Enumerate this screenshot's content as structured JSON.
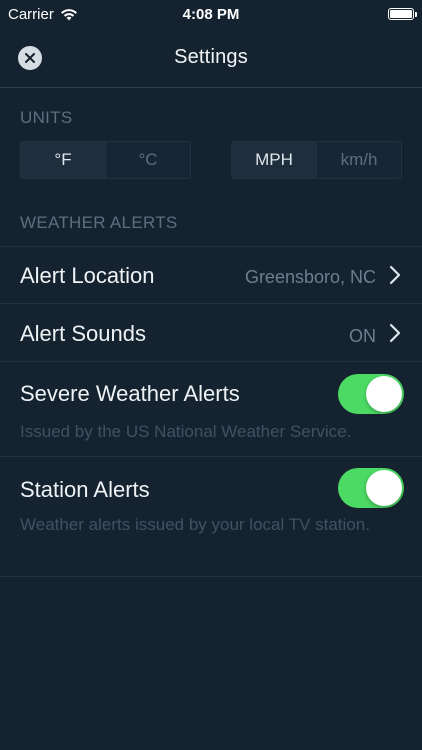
{
  "status_bar": {
    "carrier": "Carrier",
    "time": "4:08 PM"
  },
  "nav": {
    "title": "Settings"
  },
  "units": {
    "header": "UNITS",
    "temperature": {
      "options": [
        "°F",
        "°C"
      ],
      "selected": "°F"
    },
    "speed": {
      "options": [
        "MPH",
        "km/h"
      ],
      "selected": "MPH"
    }
  },
  "weather_alerts": {
    "header": "WEATHER ALERTS",
    "alert_location": {
      "label": "Alert Location",
      "value": "Greensboro, NC"
    },
    "alert_sounds": {
      "label": "Alert Sounds",
      "value": "ON"
    },
    "severe_weather": {
      "label": "Severe Weather Alerts",
      "subtitle": "Issued by the US National Weather Service.",
      "enabled": true
    },
    "station_alerts": {
      "label": "Station Alerts",
      "subtitle": "Weather alerts issued by your local TV station.",
      "enabled": true
    }
  },
  "colors": {
    "background": "#152330",
    "toggle_on": "#4cd964",
    "muted_text": "#5c6f7e"
  }
}
